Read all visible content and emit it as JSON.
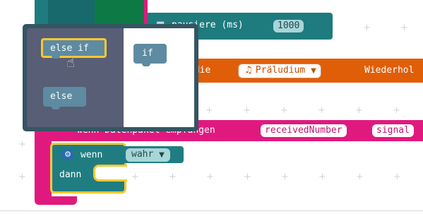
{
  "colors": {
    "grid_plus": "#cfd6dc",
    "basic_teal": "#1e7b7e",
    "basic_green": "#0d7a45",
    "music_orange": "#e05e08",
    "radio_pink": "#e0197f",
    "logic_teal": "#1f7d82",
    "logic_light": "#a8d5d8",
    "popup_bg": "#355563",
    "popup_left": "#575e75",
    "highlight": "#f7c833"
  },
  "blocks": {
    "pause": {
      "label": "pausiere (ms)",
      "value": "1000"
    },
    "melody": {
      "prefix_label": "odie",
      "melody_value": "Präludium",
      "suffix_label": "Wiederhol"
    },
    "on_received": {
      "label": "wenn Datenpaket empfangen",
      "param1": "receivedNumber",
      "param2": "signal"
    },
    "if_block": {
      "label": "wenn",
      "condition": "wahr",
      "then_label": "dann"
    }
  },
  "mutator_popup": {
    "options": [
      "else if",
      "else"
    ],
    "container_label": "if"
  }
}
